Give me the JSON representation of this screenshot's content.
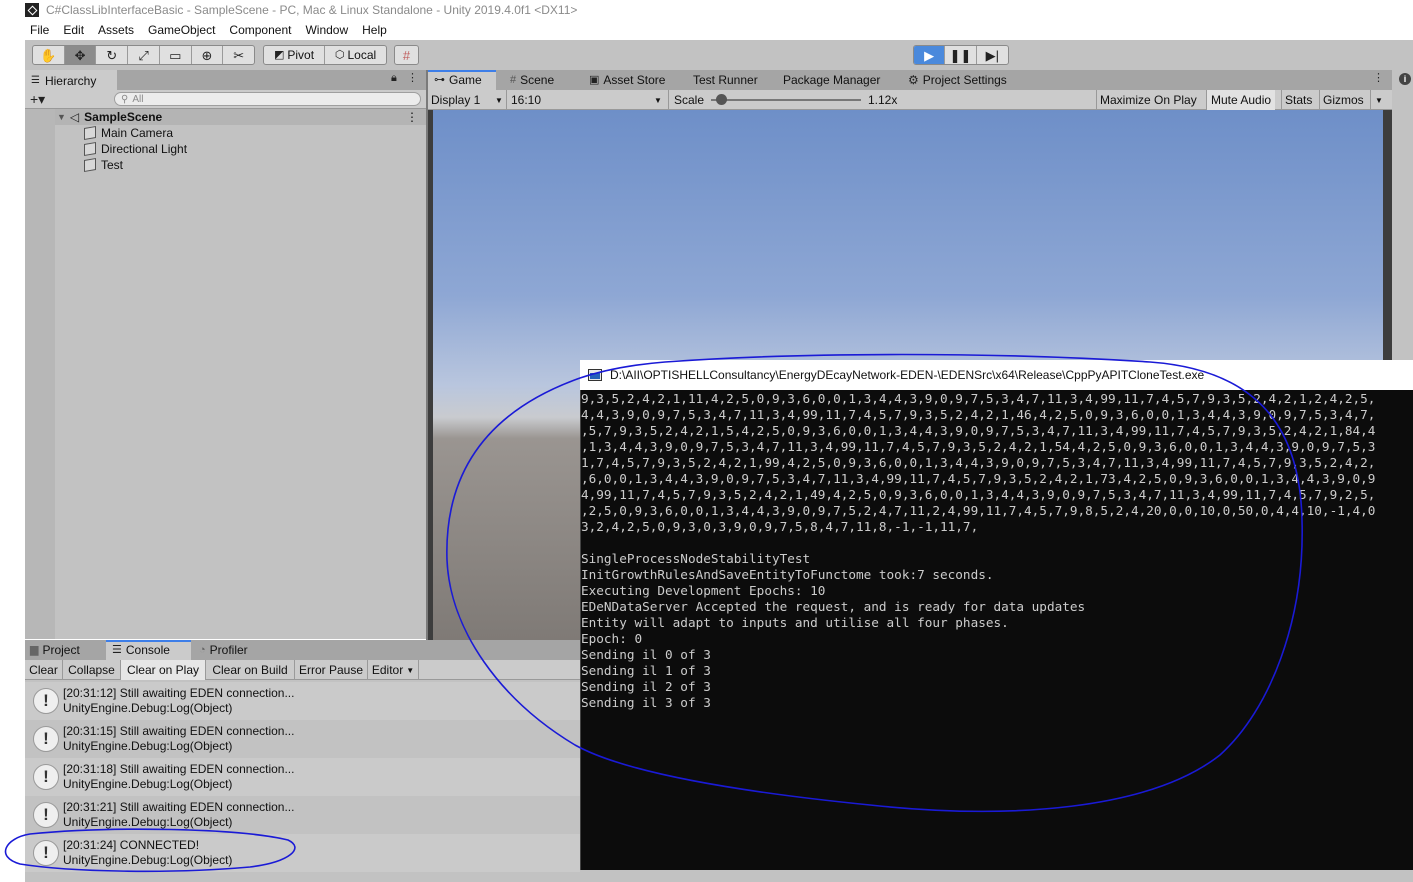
{
  "window": {
    "title": "C#ClassLibInterfaceBasic - SampleScene - PC, Mac & Linux Standalone - Unity 2019.4.0f1 <DX11>"
  },
  "menu": [
    "File",
    "Edit",
    "Assets",
    "GameObject",
    "Component",
    "Window",
    "Help"
  ],
  "toolbar": {
    "pivot_label": "Pivot",
    "local_label": "Local"
  },
  "hierarchy": {
    "tab_label": "Hierarchy",
    "search_placeholder": "All",
    "scene_name": "SampleScene",
    "objects": [
      "Main Camera",
      "Directional Light",
      "Test"
    ]
  },
  "game_tabs": [
    "Game",
    "Scene",
    "Asset Store",
    "Test Runner",
    "Package Manager",
    "Project Settings"
  ],
  "game_toolbar": {
    "display": "Display 1",
    "aspect": "16:10",
    "scale_label": "Scale",
    "scale_value": "1.12x",
    "scale_fraction": 0.07,
    "maximize": "Maximize On Play",
    "mute": "Mute Audio",
    "stats": "Stats",
    "gizmos": "Gizmos"
  },
  "bottom_tabs": [
    "Project",
    "Console",
    "Profiler"
  ],
  "console_toolbar": [
    "Clear",
    "Collapse",
    "Clear on Play",
    "Clear on Build",
    "Error Pause",
    "Editor"
  ],
  "console_logs": [
    {
      "line1": "[20:31:12] Still awaiting EDEN connection...",
      "line2": "UnityEngine.Debug:Log(Object)"
    },
    {
      "line1": "[20:31:15] Still awaiting EDEN connection...",
      "line2": "UnityEngine.Debug:Log(Object)"
    },
    {
      "line1": "[20:31:18] Still awaiting EDEN connection...",
      "line2": "UnityEngine.Debug:Log(Object)"
    },
    {
      "line1": "[20:31:21] Still awaiting EDEN connection...",
      "line2": "UnityEngine.Debug:Log(Object)"
    },
    {
      "line1": "[20:31:24] CONNECTED!",
      "line2": "UnityEngine.Debug:Log(Object)"
    }
  ],
  "terminal": {
    "title": "D:\\AII\\OPTISHELLConsultancy\\EnergyDEcayNetwork-EDEN-\\EDENSrc\\x64\\Release\\CppPyAPITCloneTest.exe",
    "lines": [
      "9,3,5,2,4,2,1,11,4,2,5,0,9,3,6,0,0,1,3,4,4,3,9,0,9,7,5,3,4,7,11,3,4,99,11,7,4,5,7,9,3,5,2,4,2,1,2,4,2,5,",
      "4,4,3,9,0,9,7,5,3,4,7,11,3,4,99,11,7,4,5,7,9,3,5,2,4,2,1,46,4,2,5,0,9,3,6,0,0,1,3,4,4,3,9,0,9,7,5,3,4,7,",
      ",5,7,9,3,5,2,4,2,1,5,4,2,5,0,9,3,6,0,0,1,3,4,4,3,9,0,9,7,5,3,4,7,11,3,4,99,11,7,4,5,7,9,3,5,2,4,2,1,84,4",
      ",1,3,4,4,3,9,0,9,7,5,3,4,7,11,3,4,99,11,7,4,5,7,9,3,5,2,4,2,1,54,4,2,5,0,9,3,6,0,0,1,3,4,4,3,9,0,9,7,5,3",
      "1,7,4,5,7,9,3,5,2,4,2,1,99,4,2,5,0,9,3,6,0,0,1,3,4,4,3,9,0,9,7,5,3,4,7,11,3,4,99,11,7,4,5,7,9,3,5,2,4,2,",
      ",6,0,0,1,3,4,4,3,9,0,9,7,5,3,4,7,11,3,4,99,11,7,4,5,7,9,3,5,2,4,2,1,73,4,2,5,0,9,3,6,0,0,1,3,4,4,3,9,0,9",
      "4,99,11,7,4,5,7,9,3,5,2,4,2,1,49,4,2,5,0,9,3,6,0,0,1,3,4,4,3,9,0,9,7,5,3,4,7,11,3,4,99,11,7,4,5,7,9,2,5,",
      ",2,5,0,9,3,6,0,0,1,3,4,4,3,9,0,9,7,5,2,4,7,11,2,4,99,11,7,4,5,7,9,8,5,2,4,20,0,0,10,0,50,0,4,4,10,-1,4,0",
      "3,2,4,2,5,0,9,3,0,3,9,0,9,7,5,8,4,7,11,8,-1,-1,11,7,",
      "",
      "SingleProcessNodeStabilityTest",
      "InitGrowthRulesAndSaveEntityToFunctome took:7 seconds.",
      "Executing Development Epochs: 10",
      "EDeNDataServer Accepted the request, and is ready for data updates",
      "Entity will adapt to inputs and utilise all four phases.",
      "Epoch: 0",
      "Sending il 0 of 3",
      "Sending il 1 of 3",
      "Sending il 2 of 3",
      "Sending il 3 of 3"
    ]
  },
  "colors": {
    "annotation": "#1a1ad6",
    "play_active": "#4a89dc",
    "tab_accent": "#3d7ee8"
  }
}
